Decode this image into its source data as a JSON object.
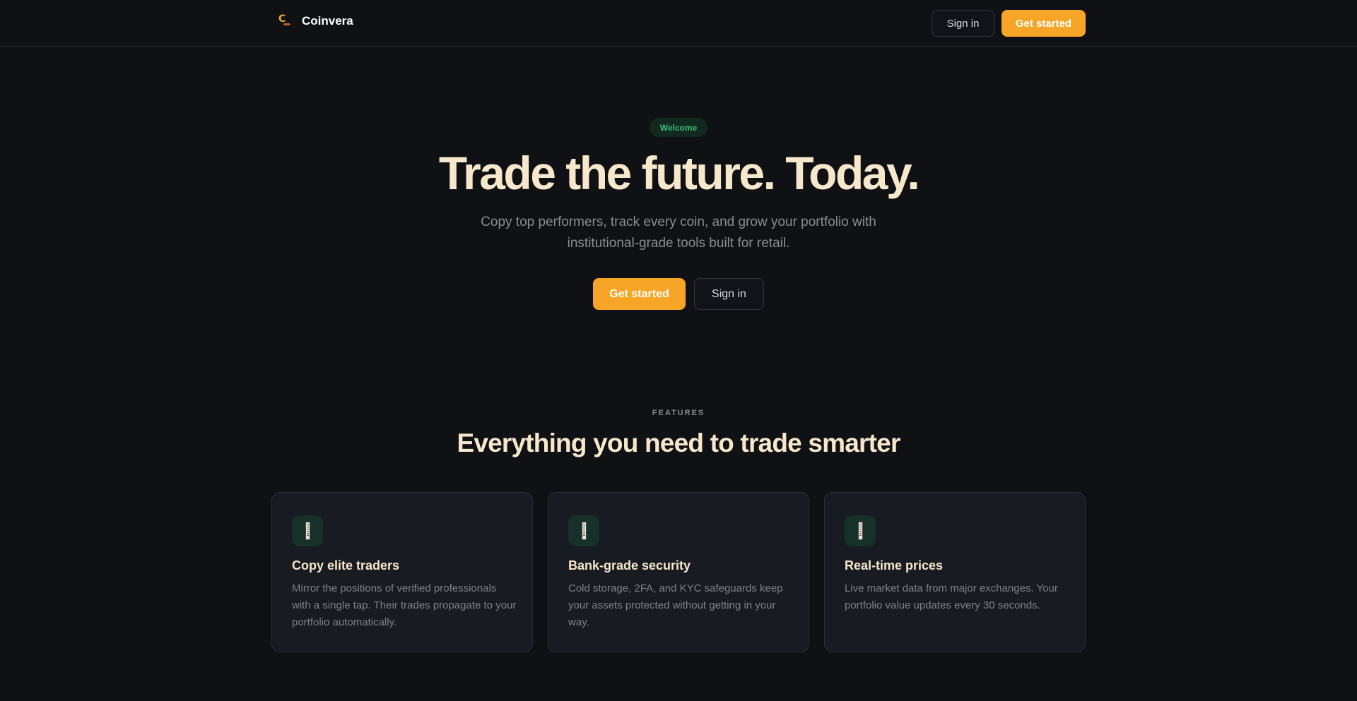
{
  "header": {
    "brand_name": "Coinvera",
    "logo_icon": "coin-logo-icon",
    "sign_in_label": "Sign in",
    "get_started_label": "Get started"
  },
  "hero": {
    "badge": "Welcome",
    "title": "Trade the future. Today.",
    "subtitle": "Copy top performers, track every coin, and grow your portfolio with institutional-grade tools built for retail.",
    "primary_label": "Get started",
    "secondary_label": "Sign in"
  },
  "features": {
    "eyebrow": "FEATURES",
    "title": "Everything you need to trade smarter",
    "items": [
      {
        "icon": "feature-icon",
        "title": "Copy elite traders",
        "text": "Mirror the positions of verified professionals with a single tap. Their trades propagate to your portfolio automatically."
      },
      {
        "icon": "feature-icon",
        "title": "Bank-grade security",
        "text": "Cold storage, 2FA, and KYC safeguards keep your assets protected without getting in your way."
      },
      {
        "icon": "feature-icon",
        "title": "Real-time prices",
        "text": "Live market data from major exchanges. Your portfolio value updates every 30 seconds."
      }
    ]
  },
  "colors": {
    "background": "#0f1115",
    "accent": "#f7a527",
    "heading": "#f7e8cc",
    "badge_text": "#3bbf7f",
    "card_bg": "#181b21"
  }
}
